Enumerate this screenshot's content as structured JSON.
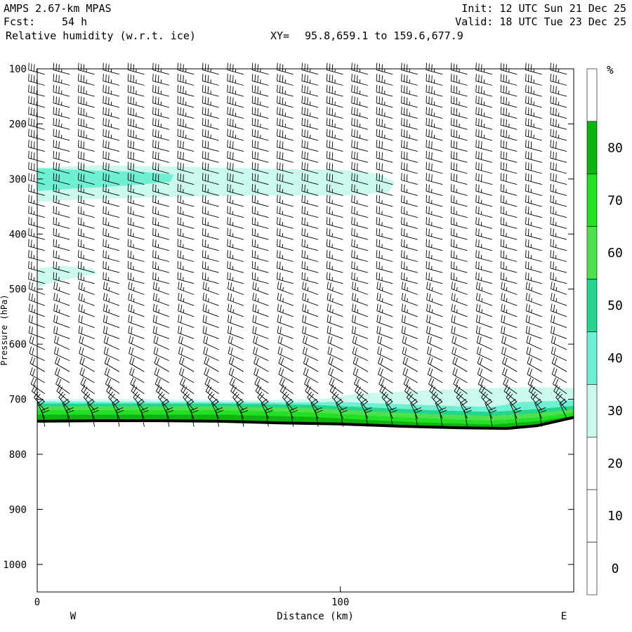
{
  "header": {
    "model": "AMPS 2.67-km MPAS",
    "fcst_label": "Fcst:",
    "fcst_value": "54 h",
    "field": "Relative humidity (w.r.t. ice)",
    "xy_label": "XY=",
    "xy_value": "95.8,659.1 to 159.6,677.9",
    "init": "Init: 12 UTC Sun 21 Dec 25",
    "valid": "Valid: 18 UTC Tue 23 Dec 25"
  },
  "chart_data": {
    "type": "heatmap",
    "title": "Relative humidity (w.r.t. ice)",
    "xlabel": "Distance (km)",
    "ylabel": "Pressure (hPa)",
    "xlim": [
      0,
      177
    ],
    "ylim": [
      1050,
      100
    ],
    "x_ticks": [
      0,
      100
    ],
    "y_ticks": [
      100,
      200,
      300,
      400,
      500,
      600,
      700,
      800,
      900,
      1000
    ],
    "left_end_label": "W",
    "right_end_label": "E",
    "colorbar": {
      "unit": "%",
      "tick_labels": [
        0,
        10,
        20,
        30,
        40,
        50,
        60,
        70,
        80
      ],
      "bins": [
        {
          "min": 30,
          "max": 40,
          "color": "#ccf9ee"
        },
        {
          "min": 40,
          "max": 50,
          "color": "#70f0d2"
        },
        {
          "min": 50,
          "max": 60,
          "color": "#22d68d"
        },
        {
          "min": 60,
          "max": 70,
          "color": "#4fe04f"
        },
        {
          "min": 70,
          "max": 80,
          "color": "#22e022"
        },
        {
          "min": 80,
          "max": 90,
          "color": "#10b410"
        }
      ]
    },
    "surface_pressure": [
      {
        "x": 0,
        "p": 740
      },
      {
        "x": 20,
        "p": 739
      },
      {
        "x": 40,
        "p": 739
      },
      {
        "x": 60,
        "p": 740
      },
      {
        "x": 80,
        "p": 743
      },
      {
        "x": 100,
        "p": 745
      },
      {
        "x": 120,
        "p": 749
      },
      {
        "x": 140,
        "p": 752
      },
      {
        "x": 155,
        "p": 753
      },
      {
        "x": 165,
        "p": 748
      },
      {
        "x": 177,
        "p": 733
      }
    ],
    "rh_regions": [
      {
        "rh": 35,
        "points": [
          [
            0,
            280
          ],
          [
            20,
            275
          ],
          [
            50,
            278
          ],
          [
            80,
            282
          ],
          [
            100,
            283
          ],
          [
            112,
            290
          ],
          [
            118,
            305
          ],
          [
            116,
            325
          ],
          [
            100,
            330
          ],
          [
            70,
            330
          ],
          [
            40,
            333
          ],
          [
            15,
            337
          ],
          [
            0,
            342
          ]
        ]
      },
      {
        "rh": 45,
        "points": [
          [
            0,
            280
          ],
          [
            20,
            285
          ],
          [
            35,
            287
          ],
          [
            45,
            292
          ],
          [
            44,
            305
          ],
          [
            30,
            312
          ],
          [
            10,
            318
          ],
          [
            0,
            322
          ]
        ]
      },
      {
        "rh": 35,
        "points": [
          [
            0,
            462
          ],
          [
            8,
            458
          ],
          [
            18,
            462
          ],
          [
            20,
            472
          ],
          [
            12,
            480
          ],
          [
            4,
            490
          ],
          [
            0,
            498
          ]
        ]
      },
      {
        "rh": 35,
        "points": [
          [
            0,
            700
          ],
          [
            40,
            700
          ],
          [
            70,
            702
          ],
          [
            95,
            699
          ],
          [
            105,
            690
          ],
          [
            125,
            685
          ],
          [
            145,
            680
          ],
          [
            165,
            678
          ],
          [
            177,
            680
          ],
          [
            177,
            733
          ],
          [
            165,
            748
          ],
          [
            155,
            753
          ],
          [
            140,
            752
          ],
          [
            120,
            749
          ],
          [
            100,
            745
          ],
          [
            80,
            743
          ],
          [
            60,
            740
          ],
          [
            40,
            739
          ],
          [
            20,
            739
          ],
          [
            0,
            740
          ]
        ]
      },
      {
        "rh": 45,
        "points": [
          [
            0,
            704
          ],
          [
            50,
            705
          ],
          [
            85,
            706
          ],
          [
            100,
            705
          ],
          [
            115,
            708
          ],
          [
            135,
            712
          ],
          [
            150,
            714
          ],
          [
            160,
            705
          ],
          [
            177,
            702
          ],
          [
            177,
            733
          ],
          [
            165,
            748
          ],
          [
            155,
            753
          ],
          [
            140,
            752
          ],
          [
            120,
            749
          ],
          [
            100,
            745
          ],
          [
            80,
            743
          ],
          [
            60,
            740
          ],
          [
            40,
            739
          ],
          [
            20,
            739
          ],
          [
            0,
            740
          ]
        ]
      },
      {
        "rh": 55,
        "points": [
          [
            0,
            708
          ],
          [
            60,
            708
          ],
          [
            90,
            710
          ],
          [
            110,
            715
          ],
          [
            130,
            720
          ],
          [
            150,
            723
          ],
          [
            165,
            718
          ],
          [
            177,
            712
          ],
          [
            177,
            733
          ],
          [
            165,
            748
          ],
          [
            155,
            753
          ],
          [
            140,
            752
          ],
          [
            120,
            749
          ],
          [
            100,
            745
          ],
          [
            80,
            743
          ],
          [
            60,
            740
          ],
          [
            40,
            739
          ],
          [
            20,
            739
          ],
          [
            0,
            740
          ]
        ]
      },
      {
        "rh": 65,
        "points": [
          [
            0,
            713
          ],
          [
            60,
            713
          ],
          [
            90,
            716
          ],
          [
            110,
            722
          ],
          [
            130,
            727
          ],
          [
            150,
            730
          ],
          [
            165,
            725
          ],
          [
            177,
            718
          ],
          [
            177,
            733
          ],
          [
            165,
            748
          ],
          [
            155,
            753
          ],
          [
            140,
            752
          ],
          [
            120,
            749
          ],
          [
            100,
            745
          ],
          [
            80,
            743
          ],
          [
            60,
            740
          ],
          [
            40,
            739
          ],
          [
            20,
            739
          ],
          [
            0,
            740
          ]
        ]
      },
      {
        "rh": 75,
        "points": [
          [
            0,
            720
          ],
          [
            60,
            720
          ],
          [
            90,
            724
          ],
          [
            110,
            730
          ],
          [
            130,
            735
          ],
          [
            150,
            739
          ],
          [
            165,
            733
          ],
          [
            177,
            724
          ],
          [
            177,
            733
          ],
          [
            165,
            748
          ],
          [
            155,
            753
          ],
          [
            140,
            752
          ],
          [
            120,
            749
          ],
          [
            100,
            745
          ],
          [
            80,
            743
          ],
          [
            60,
            740
          ],
          [
            40,
            739
          ],
          [
            20,
            739
          ],
          [
            0,
            740
          ]
        ]
      },
      {
        "rh": 85,
        "points": [
          [
            0,
            728
          ],
          [
            60,
            728
          ],
          [
            90,
            732
          ],
          [
            110,
            738
          ],
          [
            130,
            743
          ],
          [
            150,
            746
          ],
          [
            165,
            740
          ],
          [
            177,
            730
          ],
          [
            177,
            733
          ],
          [
            165,
            748
          ],
          [
            155,
            753
          ],
          [
            140,
            752
          ],
          [
            120,
            749
          ],
          [
            100,
            745
          ],
          [
            80,
            743
          ],
          [
            60,
            740
          ],
          [
            40,
            739
          ],
          [
            20,
            739
          ],
          [
            0,
            740
          ]
        ]
      }
    ],
    "wind_barbs": {
      "columns_x": [
        2.5,
        10.7,
        18.9,
        27.1,
        35.3,
        43.5,
        51.7,
        59.9,
        68.1,
        76.3,
        84.5,
        92.7,
        100.9,
        109.1,
        117.3,
        125.5,
        133.7,
        141.9,
        150.1,
        158.3,
        166.5,
        174.7
      ],
      "levels": [
        {
          "p": 110,
          "dir": 285,
          "kt": 35
        },
        {
          "p": 130,
          "dir": 285,
          "kt": 35
        },
        {
          "p": 150,
          "dir": 285,
          "kt": 35
        },
        {
          "p": 170,
          "dir": 285,
          "kt": 35
        },
        {
          "p": 190,
          "dir": 285,
          "kt": 35
        },
        {
          "p": 210,
          "dir": 285,
          "kt": 35
        },
        {
          "p": 230,
          "dir": 285,
          "kt": 35
        },
        {
          "p": 250,
          "dir": 285,
          "kt": 30
        },
        {
          "p": 270,
          "dir": 285,
          "kt": 30
        },
        {
          "p": 290,
          "dir": 285,
          "kt": 30
        },
        {
          "p": 310,
          "dir": 285,
          "kt": 30
        },
        {
          "p": 330,
          "dir": 285,
          "kt": 25
        },
        {
          "p": 350,
          "dir": 285,
          "kt": 25
        },
        {
          "p": 370,
          "dir": 285,
          "kt": 25
        },
        {
          "p": 390,
          "dir": 285,
          "kt": 25
        },
        {
          "p": 410,
          "dir": 285,
          "kt": 25
        },
        {
          "p": 430,
          "dir": 285,
          "kt": 25
        },
        {
          "p": 450,
          "dir": 285,
          "kt": 25
        },
        {
          "p": 470,
          "dir": 285,
          "kt": 25
        },
        {
          "p": 490,
          "dir": 285,
          "kt": 25
        },
        {
          "p": 510,
          "dir": 290,
          "kt": 25
        },
        {
          "p": 530,
          "dir": 290,
          "kt": 25
        },
        {
          "p": 550,
          "dir": 290,
          "kt": 25
        },
        {
          "p": 570,
          "dir": 290,
          "kt": 20
        },
        {
          "p": 590,
          "dir": 290,
          "kt": 20
        },
        {
          "p": 610,
          "dir": 295,
          "kt": 20
        },
        {
          "p": 630,
          "dir": 295,
          "kt": 20
        },
        {
          "p": 650,
          "dir": 300,
          "kt": 20
        },
        {
          "p": 670,
          "dir": 300,
          "kt": 20
        },
        {
          "p": 690,
          "dir": 305,
          "kt": 20
        },
        {
          "p": 705,
          "dir": 310,
          "kt": 20
        },
        {
          "p": 720,
          "dir": 320,
          "kt": 20
        },
        {
          "p": 735,
          "dir": 335,
          "kt": 20
        },
        {
          "p": 750,
          "dir": 350,
          "kt": 20
        }
      ]
    }
  }
}
